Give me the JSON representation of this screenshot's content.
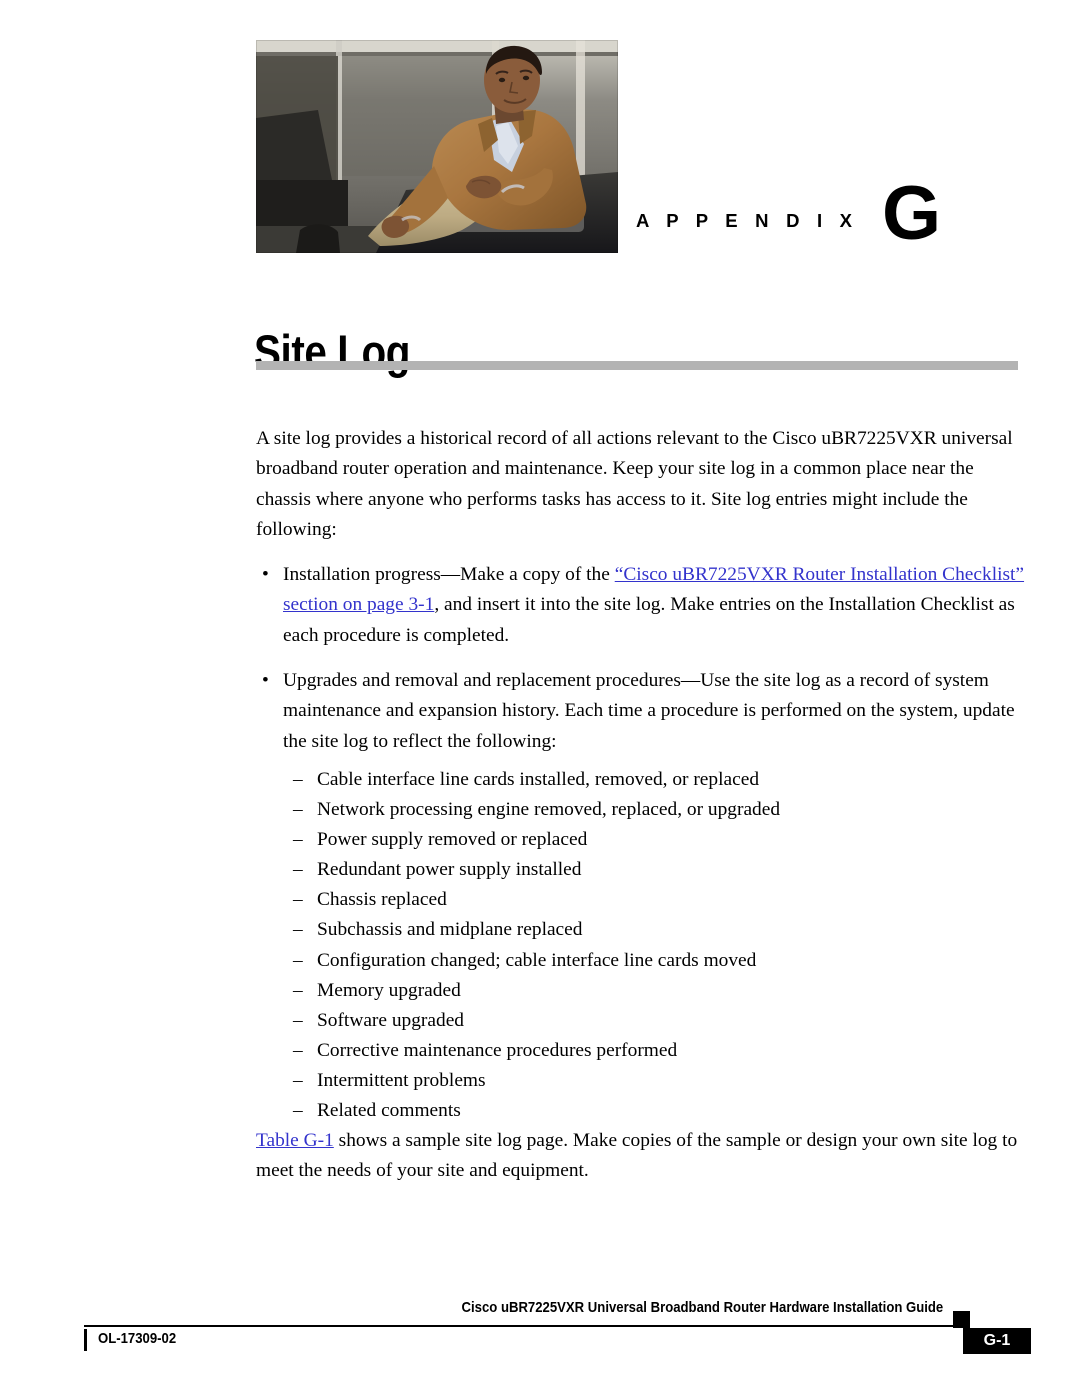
{
  "header": {
    "appendix_label": "A P P E N D I X",
    "appendix_letter": "G",
    "photo_alt": "appendix-opener-photo"
  },
  "title": "Site Log",
  "body": {
    "intro_paragraph": "A site log provides a historical record of all actions relevant to the Cisco uBR7225VXR universal broadband router operation and maintenance. Keep your site log in a common place near the chassis where anyone who performs tasks has access to it. Site log entries might include the following:",
    "bullets": [
      {
        "marker": "•",
        "text_before_link": "Installation progress—Make a copy of the ",
        "link_text": "“Cisco uBR7225VXR Router Installation Checklist” section on page 3-1",
        "text_after_link": ", and insert it into the site log. Make entries on the Installation Checklist as each procedure is completed."
      },
      {
        "marker": "•",
        "text_before_link": "Upgrades and removal and replacement procedures—Use the site log as a record of system maintenance and expansion history. Each time a procedure is performed on the system, update the site log to reflect the following:",
        "link_text": "",
        "text_after_link": ""
      }
    ],
    "dash_marker": "–",
    "dash_items": [
      "Cable interface line cards installed, removed, or replaced",
      "Network processing engine removed, replaced, or upgraded",
      "Power supply removed or replaced",
      "Redundant power supply installed",
      "Chassis replaced",
      "Subchassis and midplane replaced",
      "Configuration changed; cable interface line cards moved",
      "Memory upgraded",
      "Software upgraded",
      "Corrective maintenance procedures performed",
      "Intermittent problems",
      "Related comments"
    ],
    "closing_paragraph": {
      "link_text": "Table G-1",
      "text_after_link": " shows a sample site log page. Make copies of the sample or design your own site log to meet the needs of your site and equipment."
    }
  },
  "footer": {
    "doc_title": "Cisco uBR7225VXR Universal Broadband Router Hardware Installation Guide",
    "doc_id": "OL-17309-02",
    "page_number": "G-1"
  },
  "colors": {
    "link": "#3333cc",
    "title_rule": "#b3b3b3",
    "text": "#000000",
    "footer_block": "#000000"
  }
}
